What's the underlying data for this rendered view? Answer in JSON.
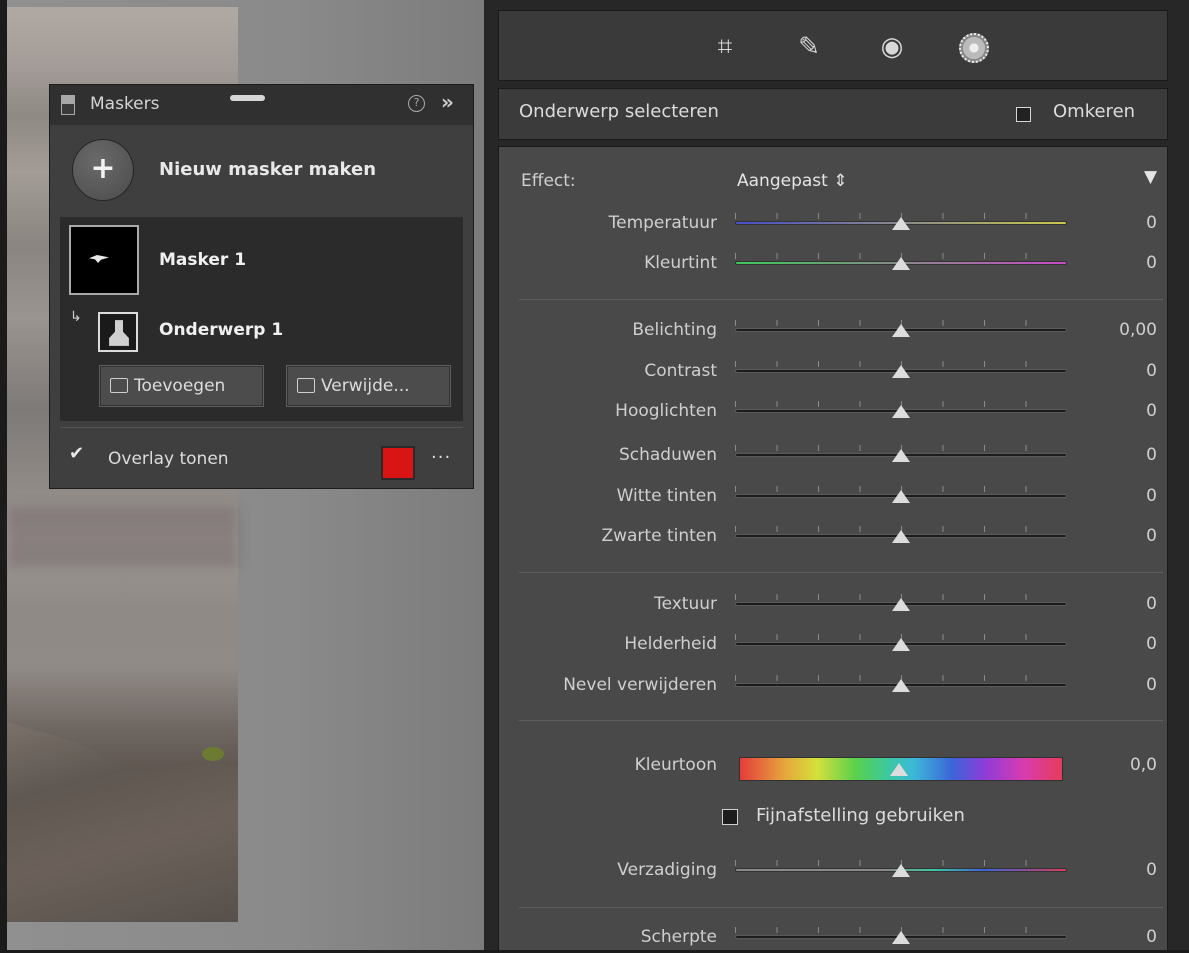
{
  "masks_panel": {
    "title": "Maskers",
    "help_icon": "?",
    "expand_icon": "»",
    "new_mask_label": "Nieuw masker maken",
    "mask_name": "Masker 1",
    "sub_arrow": "↳",
    "subject_name": "Onderwerp 1",
    "add_label": "Toevoegen",
    "remove_label": "Verwijde...",
    "overlay_check": "✔",
    "overlay_label": "Overlay tonen",
    "overlay_color": "#d81414",
    "more": "···"
  },
  "toolbar": {
    "crop_icon": "⌗",
    "heal_icon": "✎",
    "redeye_icon": "◉"
  },
  "subject_bar": {
    "label": "Onderwerp selecteren",
    "invert_label": "Omkeren"
  },
  "effect": {
    "label": "Effect:",
    "value": "Aangepast ⇕",
    "collapse": "▼"
  },
  "sliders": {
    "temperatuur": {
      "label": "Temperatuur",
      "value": "0"
    },
    "kleurtint": {
      "label": "Kleurtint",
      "value": "0"
    },
    "belichting": {
      "label": "Belichting",
      "value": "0,00"
    },
    "contrast": {
      "label": "Contrast",
      "value": "0"
    },
    "hooglichten": {
      "label": "Hooglichten",
      "value": "0"
    },
    "schaduwen": {
      "label": "Schaduwen",
      "value": "0"
    },
    "witte": {
      "label": "Witte tinten",
      "value": "0"
    },
    "zwarte": {
      "label": "Zwarte tinten",
      "value": "0"
    },
    "textuur": {
      "label": "Textuur",
      "value": "0"
    },
    "helderheid": {
      "label": "Helderheid",
      "value": "0"
    },
    "nevel": {
      "label": "Nevel verwijderen",
      "value": "0"
    },
    "kleurtoon": {
      "label": "Kleurtoon",
      "value": "0,0"
    },
    "verzadiging": {
      "label": "Verzadiging",
      "value": "0"
    },
    "scherpte": {
      "label": "Scherpte",
      "value": "0"
    }
  },
  "fine_tune_label": "Fijnafstelling gebruiken",
  "colors": {
    "temperature_track": [
      "#4a4fc9",
      "#c8c84a"
    ],
    "tint_track": [
      "#3cc85a",
      "#c84ac8"
    ]
  }
}
